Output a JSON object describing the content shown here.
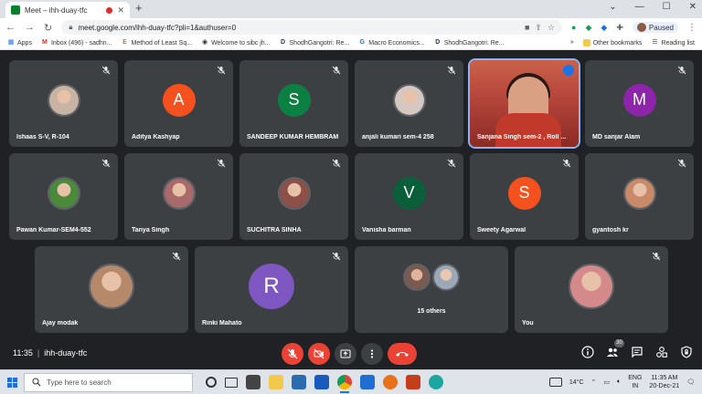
{
  "browser": {
    "tab_title": "Meet – ihh-duay-tfc",
    "tab_close": "✕",
    "new_tab": "+",
    "window_buttons": [
      "⌄",
      "—",
      "☐",
      "✕"
    ],
    "url": "meet.google.com/ihh-duay-tfc?pli=1&authuser=0",
    "profile_label": "Paused"
  },
  "bookmarks": {
    "items": [
      {
        "label": "Apps",
        "icon": "▦",
        "color": "#1a73e8"
      },
      {
        "label": "Inbox (496) - sadhn...",
        "icon": "M",
        "color": "#d93025"
      },
      {
        "label": "Method of Least Sq...",
        "icon": "E",
        "color": "#e37400"
      },
      {
        "label": "Welcome to sibc jh...",
        "icon": "◉",
        "color": "#333333"
      },
      {
        "label": "ShodhGangotri: Re...",
        "icon": "D",
        "color": "#1f3b73"
      },
      {
        "label": "Macro Economics...",
        "icon": "G",
        "color": "#1a73e8"
      },
      {
        "label": "ShodhGangotri: Re...",
        "icon": "D",
        "color": "#1f3b73"
      }
    ],
    "more": "»",
    "other": "Other bookmarks",
    "reading": "Reading list"
  },
  "participants": [
    {
      "name": "Ishaas S-V, R-104",
      "type": "photo",
      "color": "#c9b3a3"
    },
    {
      "name": "Aditya Kashyap",
      "type": "letter",
      "letter": "A",
      "color": "#f4511e"
    },
    {
      "name": "SANDEEP KUMAR HEMBRAM",
      "type": "letter",
      "letter": "S",
      "color": "#0b8043"
    },
    {
      "name": "anjali kumari sem-4 258",
      "type": "photo",
      "color": "#d6c8c0"
    },
    {
      "name": "Sanjana Singh sem-2 , Roll ...",
      "type": "video",
      "color": "#b8473c"
    },
    {
      "name": "MD sanjar Alam",
      "type": "letter",
      "letter": "M",
      "color": "#8e24aa"
    },
    {
      "name": "Pawan Kumar-SEM4-552",
      "type": "photo",
      "color": "#4a8a3a"
    },
    {
      "name": "Tanya Singh",
      "type": "photo",
      "color": "#a86a6a"
    },
    {
      "name": "SUCHITRA SINHA",
      "type": "photo",
      "color": "#8c5048"
    },
    {
      "name": "Vanisha barman",
      "type": "letter",
      "letter": "V",
      "color": "#0b5e3a"
    },
    {
      "name": "Sweety Agarwal",
      "type": "letter",
      "letter": "S",
      "color": "#f4511e"
    },
    {
      "name": "gyantosh kr",
      "type": "photo",
      "color": "#c98a6a"
    },
    {
      "name": "Ajay modak",
      "type": "photo",
      "color": "#b5896a"
    },
    {
      "name": "Rinki Mahato",
      "type": "letter",
      "letter": "R",
      "color": "#7e57c2"
    },
    {
      "name": "15 others",
      "type": "others",
      "color": "#5f6368"
    },
    {
      "name": "You",
      "type": "photo",
      "color": "#d48a8a"
    }
  ],
  "controls": {
    "time": "11:35",
    "meeting_code": "ihh-duay-tfc",
    "people_count": "30"
  },
  "taskbar": {
    "search_placeholder": "Type here to search",
    "temperature": "14°C",
    "language_top": "ENG",
    "language_bottom": "IN",
    "time": "11:35 AM",
    "date": "20-Dec-21"
  }
}
